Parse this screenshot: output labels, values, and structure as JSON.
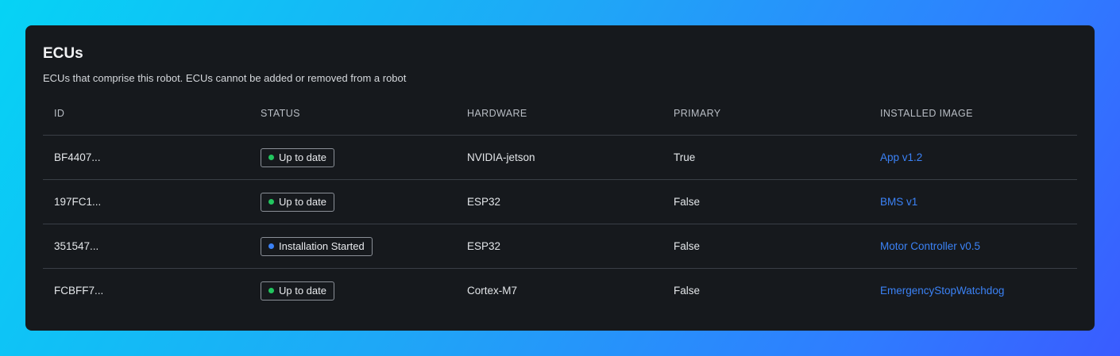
{
  "panel": {
    "title": "ECUs",
    "subtitle": "ECUs that comprise this robot. ECUs cannot be added or removed from a robot"
  },
  "table": {
    "headers": [
      "ID",
      "STATUS",
      "HARDWARE",
      "PRIMARY",
      "INSTALLED IMAGE"
    ],
    "rows": [
      {
        "id": "BF4407...",
        "status": "Up to date",
        "status_color": "#22c55e",
        "hardware": "NVIDIA-jetson",
        "primary": "True",
        "image": "App v1.2"
      },
      {
        "id": "197FC1...",
        "status": "Up to date",
        "status_color": "#22c55e",
        "hardware": "ESP32",
        "primary": "False",
        "image": "BMS v1"
      },
      {
        "id": "351547...",
        "status": "Installation Started",
        "status_color": "#3b82f6",
        "hardware": "ESP32",
        "primary": "False",
        "image": "Motor Controller v0.5"
      },
      {
        "id": "FCBFF7...",
        "status": "Up to date",
        "status_color": "#22c55e",
        "hardware": "Cortex-M7",
        "primary": "False",
        "image": "EmergencyStopWatchdog"
      }
    ]
  },
  "colors": {
    "link": "#3b82f6",
    "status_ok": "#22c55e",
    "status_progress": "#3b82f6"
  }
}
